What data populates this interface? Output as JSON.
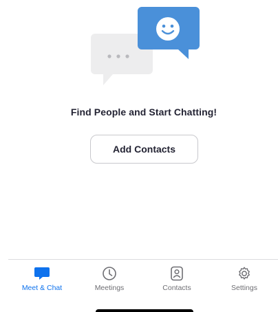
{
  "empty_state": {
    "headline": "Find People and Start Chatting!",
    "add_contacts_label": "Add Contacts",
    "illustration_icons": [
      "gray-chat-bubble-icon",
      "blue-smiley-chat-bubble-icon"
    ]
  },
  "tabbar": {
    "tabs": [
      {
        "label": "Meet & Chat",
        "icon": "chat-bubble-icon",
        "active": true
      },
      {
        "label": "Meetings",
        "icon": "clock-icon",
        "active": false
      },
      {
        "label": "Contacts",
        "icon": "contact-card-icon",
        "active": false
      },
      {
        "label": "Settings",
        "icon": "gear-icon",
        "active": false
      }
    ]
  },
  "colors": {
    "accent": "#0e72ed",
    "bubble_blue": "#4a90d9",
    "bubble_gray": "#ededee",
    "inactive": "#6e6e73"
  }
}
